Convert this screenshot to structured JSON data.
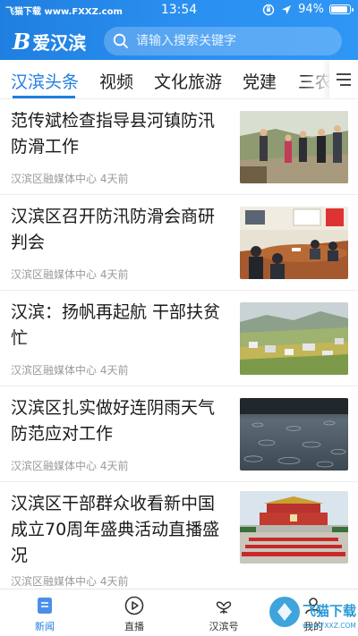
{
  "status_bar": {
    "carrier_prefix": "飞",
    "carrier_text": "飞猫下载 www.FXXZ.com",
    "time": "13:54",
    "battery": "94%"
  },
  "header": {
    "logo_text": "爱汉滨",
    "logo_mark": "B",
    "search_placeholder": "请输入搜索关键字"
  },
  "tabs": [
    {
      "label": "汉滨头条",
      "active": true
    },
    {
      "label": "视频"
    },
    {
      "label": "文化旅游"
    },
    {
      "label": "党建"
    },
    {
      "label": "三农"
    }
  ],
  "news": [
    {
      "title": "范传斌检查指导县河镇防汛防滑工作",
      "source": "汉滨区融媒体中心",
      "time": "4天前",
      "thumb": "field-inspection"
    },
    {
      "title": "汉滨区召开防汛防滑会商研判会",
      "source": "汉滨区融媒体中心",
      "time": "4天前",
      "thumb": "meeting-room"
    },
    {
      "title": "汉滨：扬帆再起航 干部扶贫忙",
      "source": "汉滨区融媒体中心",
      "time": "4天前",
      "thumb": "village-landscape"
    },
    {
      "title": "汉滨区扎实做好连阴雨天气防范应对工作",
      "source": "汉滨区融媒体中心",
      "time": "4天前",
      "thumb": "rain-water"
    },
    {
      "title": "汉滨区干部群众收看新中国成立70周年盛典活动直播盛况",
      "source": "汉滨区融媒体中心",
      "time": "4天前",
      "thumb": "parade-tiananmen"
    }
  ],
  "bottom_nav": [
    {
      "label": "新闻",
      "icon": "news-icon",
      "active": true
    },
    {
      "label": "直播",
      "icon": "play-icon"
    },
    {
      "label": "汉滨号",
      "icon": "heart-flower-icon"
    },
    {
      "label": "我的",
      "icon": "user-icon"
    }
  ],
  "watermark": {
    "text": "飞猫下载",
    "subtext": "www.FXXZ.COM"
  },
  "colors": {
    "brand_blue": "#1f7fe0",
    "text_gray": "#9a9a9a"
  }
}
